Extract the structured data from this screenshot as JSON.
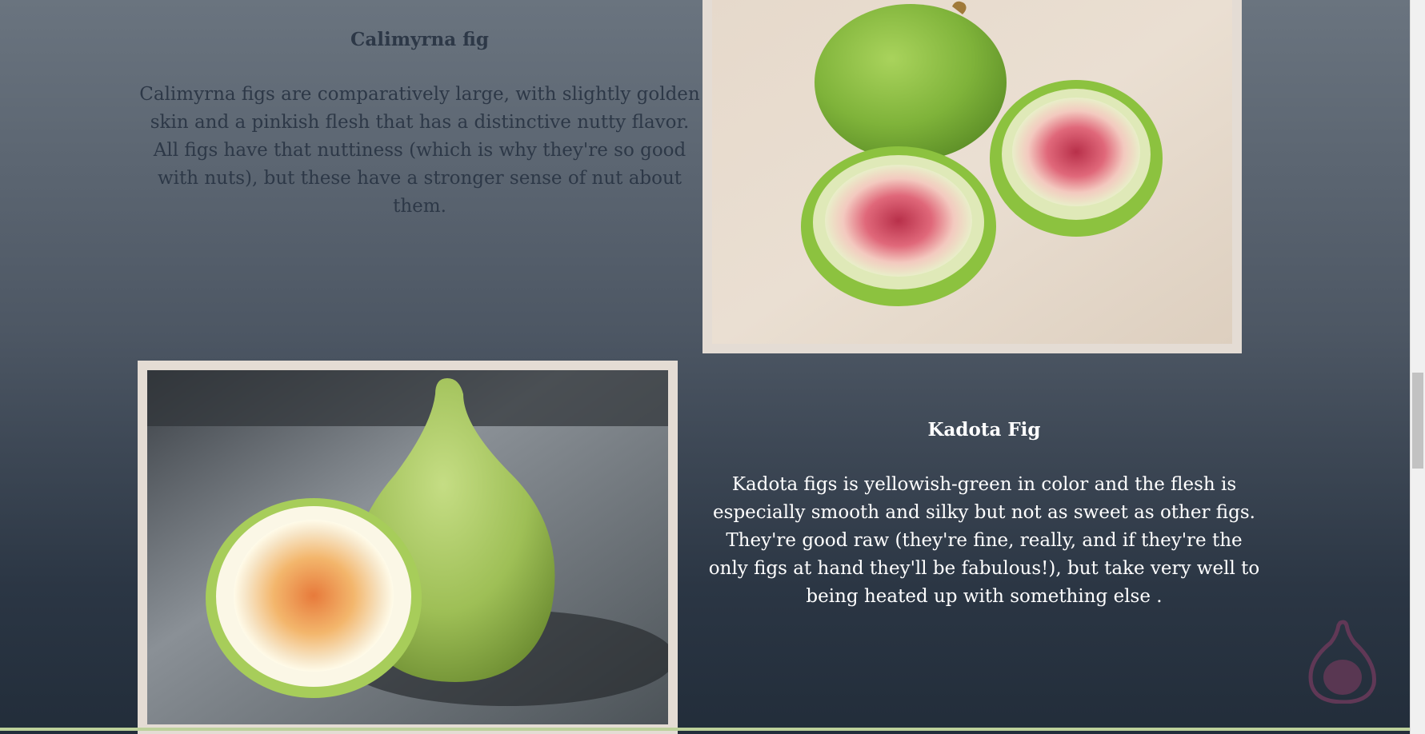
{
  "sections": {
    "calimyrna": {
      "title": "Calimyrna fig",
      "body": "Calimyrna figs are comparatively large, with slightly golden skin and a pinkish flesh that has a distinctive nutty flavor. All figs have that nuttiness (which is why they're so good with nuts), but these have a stronger sense of nut about them."
    },
    "kadota": {
      "title": "Kadota Fig",
      "body": "Kadota figs is yellowish-green in color and the flesh is especially smooth and silky but not as sweet as other figs. They're good raw (they're fine, really, and if they're the only figs at hand they'll be fabulous!), but take very well to being heated up with something else ."
    }
  },
  "colors": {
    "background_top": "#6a747f",
    "background_bottom": "#222d3a",
    "frame": "#e4dcd4",
    "dark_text": "#2d3847",
    "light_text": "#ffffff",
    "logo": "#6b3a5a"
  },
  "icons": {
    "logo": "fig-logo-icon"
  }
}
